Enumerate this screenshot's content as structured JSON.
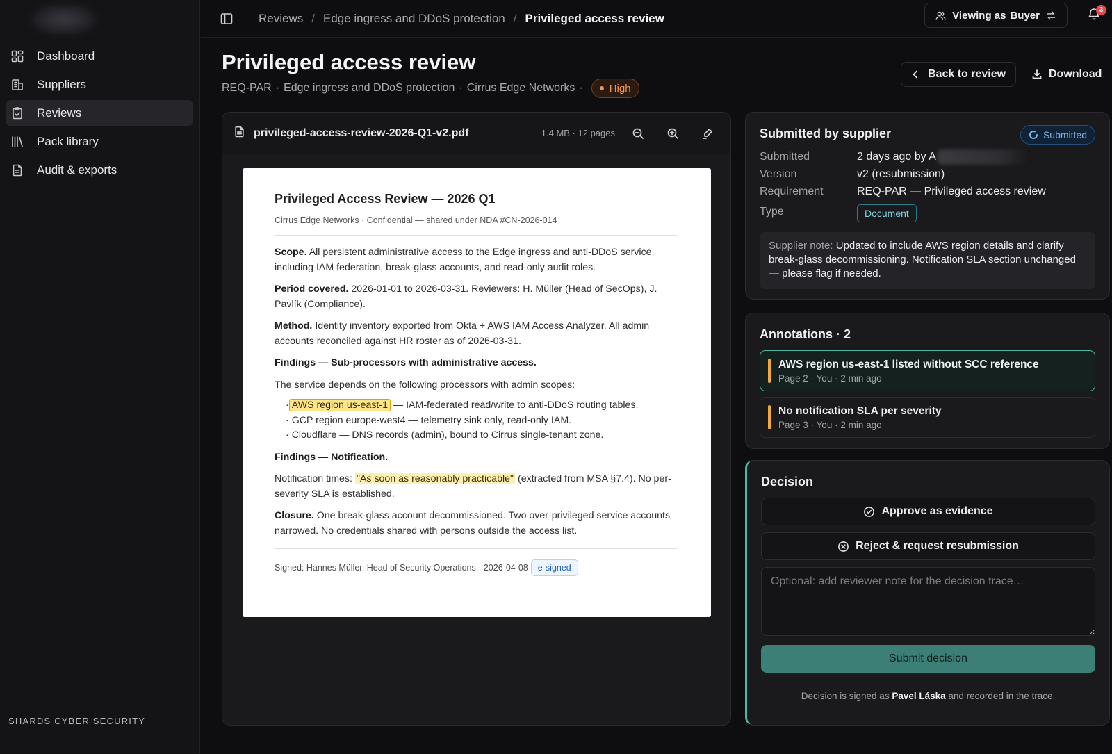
{
  "sidebar": {
    "items": [
      {
        "label": "Dashboard",
        "icon": "grid-icon"
      },
      {
        "label": "Suppliers",
        "icon": "building-icon"
      },
      {
        "label": "Reviews",
        "icon": "clipboard-check-icon",
        "active": true
      },
      {
        "label": "Pack library",
        "icon": "library-icon"
      },
      {
        "label": "Audit & exports",
        "icon": "file-export-icon"
      }
    ],
    "footer": "SHARDS CYBER SECURITY"
  },
  "topbar": {
    "breadcrumbs": [
      "Reviews",
      "Edge ingress and DDoS protection",
      "Privileged access review"
    ],
    "separator": "/",
    "viewing_label": "Viewing as",
    "viewing_role": "Buyer",
    "notification_count": "3"
  },
  "header": {
    "title": "Privileged access review",
    "req_id": "REQ-PAR",
    "service": "Edge ingress and DDoS protection",
    "supplier": "Cirrus Edge Networks",
    "dot": "·",
    "severity": "High",
    "back_label": "Back to review",
    "download_label": "Download"
  },
  "viewer": {
    "filename": "privileged-access-review-2026-Q1-v2.pdf",
    "filesize": "1.4 MB · 12 pages",
    "doc": {
      "title": "Privileged Access Review — 2026 Q1",
      "subtitle": "Cirrus Edge Networks · Confidential — shared under NDA #CN-2026-014",
      "scope_label": "Scope.",
      "scope_text": " All persistent administrative access to the Edge ingress and anti-DDoS service, including IAM federation, break-glass accounts, and read-only audit roles.",
      "period_label": "Period covered.",
      "period_text": " 2026-01-01 to 2026-03-31. Reviewers: H. Müller (Head of SecOps), J. Pavlík (Compliance).",
      "method_label": "Method.",
      "method_text": " Identity inventory exported from Okta + AWS IAM Access Analyzer. All admin accounts reconciled against HR roster as of 2026-03-31.",
      "findings_sub_label": "Findings — Sub-processors with administrative access.",
      "findings_sub_intro": "The service depends on the following processors with admin scopes:",
      "bullet": "·",
      "item1_highlight": "AWS region us-east-1",
      "item1_text": " — IAM-federated read/write to anti-DDoS routing tables.",
      "item2": "GCP region europe-west4 — telemetry sink only, read-only IAM.",
      "item3": "Cloudflare — DNS records (admin), bound to Cirrus single-tenant zone.",
      "findings_notif_label": "Findings — Notification.",
      "notif_prefix": "Notification times: ",
      "notif_highlight": "\"As soon as reasonably practicable\"",
      "notif_suffix": " (extracted from MSA §7.4). No per-severity SLA is established.",
      "closure_label": "Closure.",
      "closure_text": " One break-glass account decommissioned. Two over-privileged service accounts narrowed. No credentials shared with persons outside the access list.",
      "signed": "Signed: Hannes Müller, Head of Security Operations · 2026-04-08",
      "esigned": "e-signed"
    }
  },
  "submission": {
    "title": "Submitted by supplier",
    "status": "Submitted",
    "rows": [
      {
        "k": "Submitted",
        "v": "2 days ago by A"
      },
      {
        "k": "Version",
        "v": "v2 (resubmission)"
      },
      {
        "k": "Requirement",
        "v": "REQ-PAR — Privileged access review"
      },
      {
        "k": "Type",
        "v": "Document"
      }
    ],
    "note_label": "Supplier note:",
    "note_text": " Updated to include AWS region details and clarify break-glass decommissioning. Notification SLA section unchanged — please flag if needed."
  },
  "annotations": {
    "title": "Annotations · 2",
    "items": [
      {
        "title": "AWS region us-east-1 listed without SCC reference",
        "meta": "Page 2 · You · 2 min ago"
      },
      {
        "title": "No notification SLA per severity",
        "meta": "Page 3 · You · 2 min ago"
      }
    ]
  },
  "decision": {
    "title": "Decision",
    "approve_label": "Approve as evidence",
    "reject_label": "Reject & request resubmission",
    "note_placeholder": "Optional: add reviewer note for the decision trace…",
    "submit_label": "Submit decision",
    "foot_prefix": "Decision is signed as ",
    "foot_name": "Pavel Láska",
    "foot_suffix": " and recorded in the trace."
  },
  "colors": {
    "accent": "#4fb7a4",
    "severity_high": "#f29655",
    "annotation_marker": "#f2a93b",
    "status_submitted": "#7fb3ea"
  }
}
